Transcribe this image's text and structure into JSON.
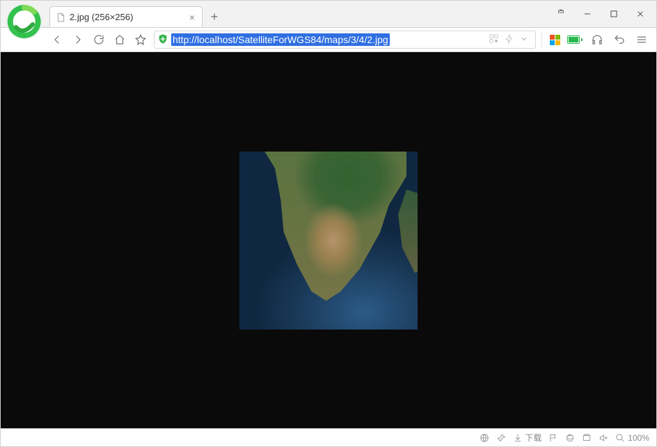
{
  "tab": {
    "title": "2.jpg (256×256)"
  },
  "addressbar": {
    "url": "http://localhost/SatelliteForWGS84/maps/3/4/2.jpg"
  },
  "statusbar": {
    "download_label": "下载",
    "zoom_label": "100%"
  }
}
